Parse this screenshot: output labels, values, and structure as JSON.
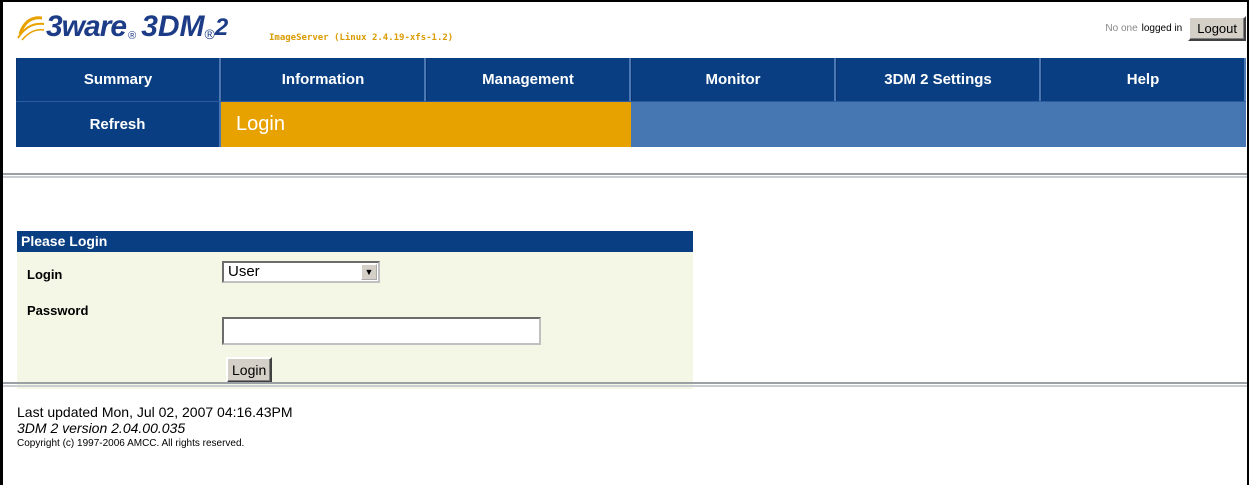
{
  "header": {
    "brand": "3ware",
    "brand_reg": "®",
    "product": "3DM",
    "product_reg": "®",
    "product_suffix": "2",
    "server_info": "ImageServer (Linux 2.4.19-xfs-1.2)",
    "user_status": "No one",
    "logged_in_label": "logged in",
    "logout_label": "Logout"
  },
  "nav": {
    "tabs": [
      {
        "label": "Summary"
      },
      {
        "label": "Information"
      },
      {
        "label": "Management"
      },
      {
        "label": "Monitor"
      },
      {
        "label": "3DM 2 Settings"
      },
      {
        "label": "Help"
      }
    ],
    "refresh_label": "Refresh",
    "current_page": "Login"
  },
  "login": {
    "title": "Please Login",
    "login_label": "Login",
    "login_select_value": "User",
    "password_label": "Password",
    "password_value": "",
    "submit_label": "Login"
  },
  "footer": {
    "last_updated": "Last updated Mon, Jul 02, 2007 04:16.43PM",
    "version": "3DM 2 version 2.04.00.035",
    "copyright": "Copyright (c) 1997-2006 AMCC. All rights reserved."
  },
  "colors": {
    "nav_blue": "#093f82",
    "accent_orange": "#e8a200",
    "panel_bg": "#f4f6e6"
  }
}
